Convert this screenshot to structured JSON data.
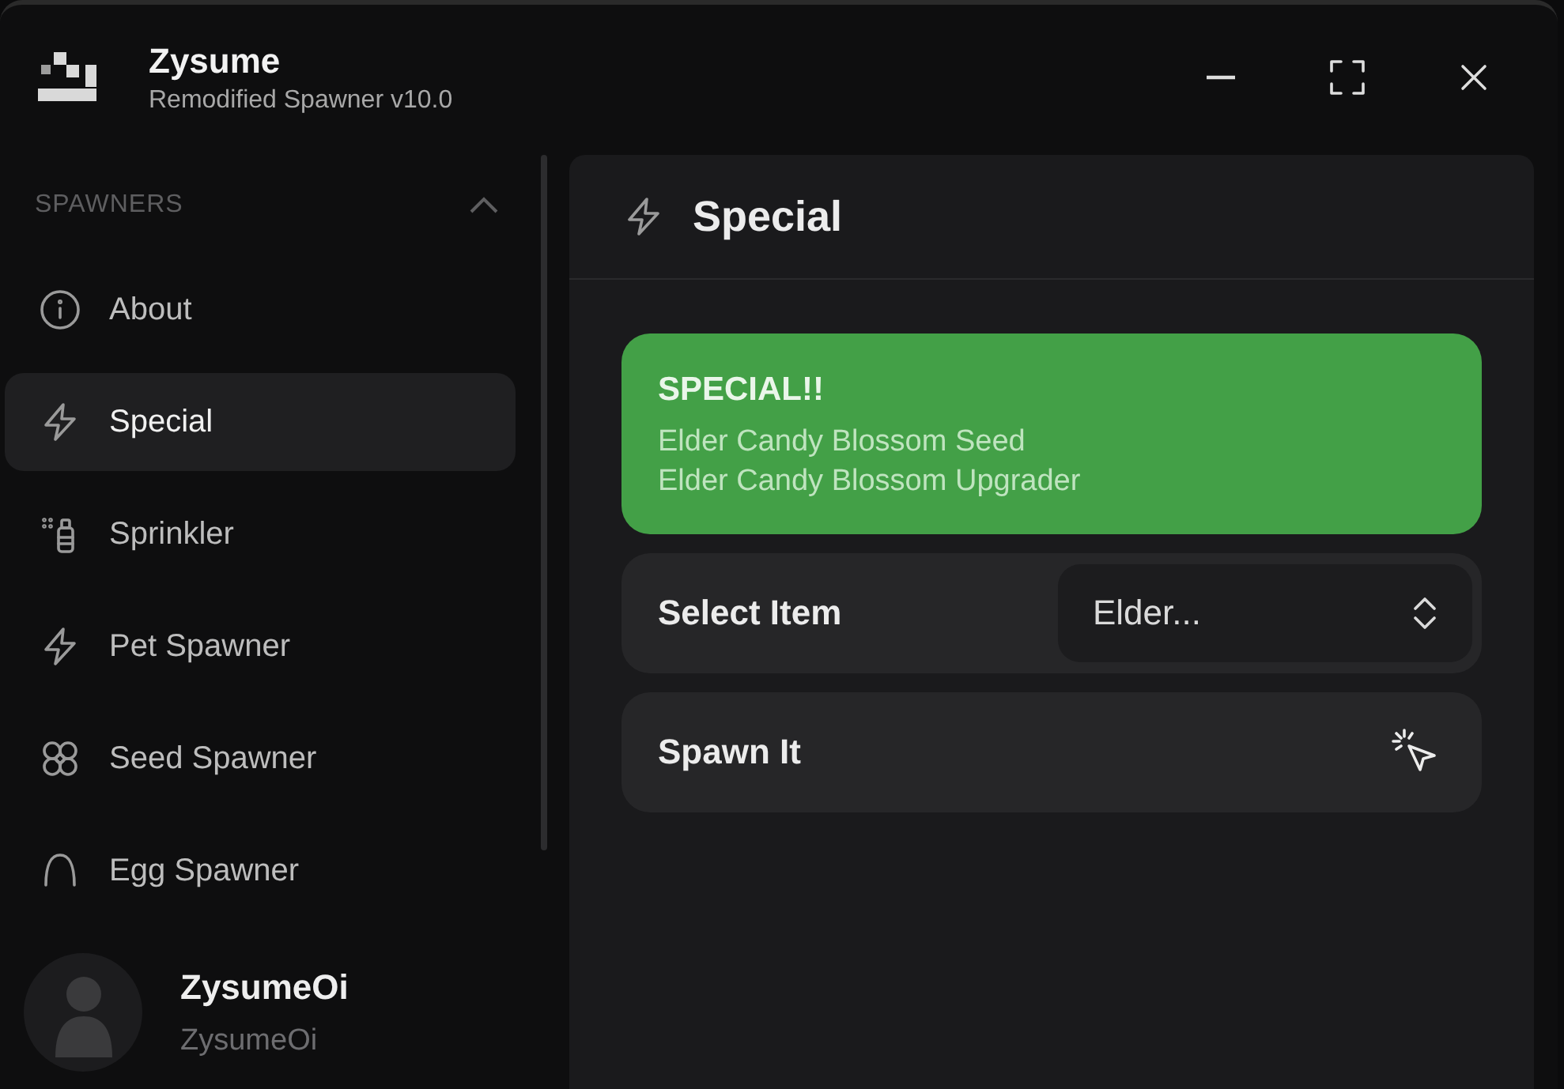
{
  "window": {
    "title": "Zysume",
    "subtitle": "Remodified Spawner v10.0"
  },
  "sidebar": {
    "section": {
      "label": "SPAWNERS",
      "expanded": true
    },
    "items": [
      {
        "label": "About",
        "selected": false
      },
      {
        "label": "Special",
        "selected": true
      },
      {
        "label": "Sprinkler",
        "selected": false
      },
      {
        "label": "Pet Spawner",
        "selected": false
      },
      {
        "label": "Seed Spawner",
        "selected": false
      },
      {
        "label": "Egg Spawner",
        "selected": false
      }
    ],
    "user": {
      "name": "ZysumeOi",
      "handle": "ZysumeOi"
    }
  },
  "main": {
    "title": "Special",
    "notice": {
      "heading": "SPECIAL!!",
      "lines": [
        "Elder Candy Blossom Seed",
        "Elder Candy Blossom Upgrader"
      ]
    },
    "controls": [
      {
        "kind": "dropdown",
        "label": "Select Item",
        "value": "Elder..."
      },
      {
        "kind": "button",
        "label": "Spawn It"
      }
    ]
  }
}
